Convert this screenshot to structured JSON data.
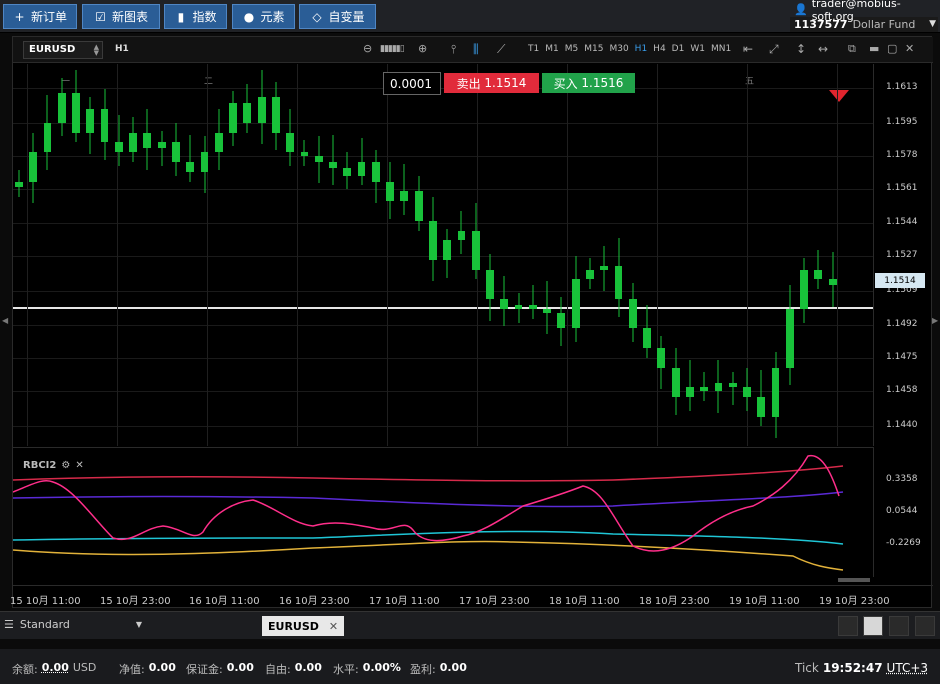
{
  "toolbar": {
    "new_order": "新订单",
    "new_chart": "新图表",
    "indices": "指数",
    "elements": "元素",
    "variables": "自变量"
  },
  "account": {
    "email": "trader@mobius-soft.org",
    "id": "1137577",
    "name": "Dollar Fund"
  },
  "chart": {
    "symbol": "EURUSD",
    "timeframe": "H1",
    "timeframes": [
      "T1",
      "M1",
      "M5",
      "M15",
      "M30",
      "H1",
      "H4",
      "D1",
      "W1",
      "MN1"
    ],
    "active_timeframe": "H1",
    "weekday_marks": [
      "一",
      "二",
      "五"
    ],
    "lot": "0.0001",
    "sell_label": "卖出",
    "sell_price": "1.1514",
    "buy_label": "买入",
    "buy_price": "1.1516",
    "current_price": "1.1514",
    "price_ticks": [
      "1.1613",
      "1.1595",
      "1.1578",
      "1.1561",
      "1.1544",
      "1.1527",
      "1.1509",
      "1.1492",
      "1.1475",
      "1.1458",
      "1.1440"
    ],
    "indicator_name": "RBCI2",
    "indicator_ticks": [
      "0.3358",
      "0.0544",
      "-0.2269"
    ],
    "x_ticks": [
      "15 10月 11:00",
      "15 10月 23:00",
      "16 10月 11:00",
      "16 10月 23:00",
      "17 10月 11:00",
      "17 10月 23:00",
      "18 10月 11:00",
      "18 10月 23:00",
      "19 10月 11:00",
      "19 10月 23:00"
    ]
  },
  "chart_data": {
    "type": "candlestick",
    "symbol": "EURUSD",
    "ylim": [
      1.143,
      1.1625
    ],
    "closes_approx": [
      1.1565,
      1.158,
      1.1595,
      1.161,
      1.159,
      1.1602,
      1.1585,
      1.158,
      1.159,
      1.1582,
      1.1585,
      1.1575,
      1.157,
      1.158,
      1.159,
      1.1605,
      1.1595,
      1.1608,
      1.159,
      1.158,
      1.1578,
      1.1575,
      1.1572,
      1.1568,
      1.1575,
      1.1565,
      1.1555,
      1.156,
      1.1545,
      1.1525,
      1.1535,
      1.154,
      1.152,
      1.1505,
      1.15,
      1.1502,
      1.15,
      1.1498,
      1.149,
      1.1515,
      1.152,
      1.1522,
      1.1505,
      1.149,
      1.148,
      1.147,
      1.1455,
      1.146,
      1.1458,
      1.1462,
      1.146,
      1.1455,
      1.1445,
      1.147,
      1.15,
      1.152,
      1.1515,
      1.1512
    ]
  },
  "bottom": {
    "layout_label": "Standard",
    "tab_symbol": "EURUSD"
  },
  "status": {
    "balance_label": "余额:",
    "balance": "0.00",
    "currency": "USD",
    "equity_label": "净值:",
    "equity": "0.00",
    "margin_label": "保证金:",
    "margin": "0.00",
    "free_label": "自由:",
    "free": "0.00",
    "level_label": "水平:",
    "level": "0.00%",
    "profit_label": "盈利:",
    "profit": "0.00",
    "tick_label": "Tick",
    "time": "19:52:47",
    "tz": "UTC+3"
  }
}
